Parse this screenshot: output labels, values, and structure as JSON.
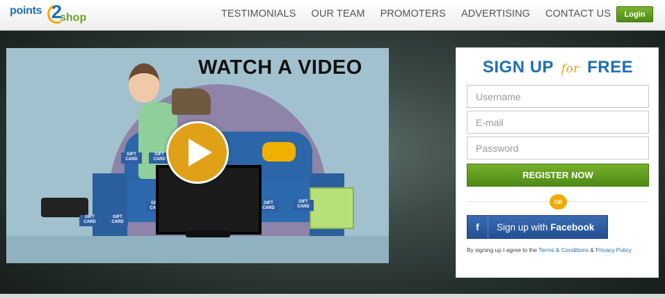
{
  "logo": {
    "part1": "points",
    "number": "2",
    "part2": "shop"
  },
  "nav": {
    "items": [
      "TESTIMONIALS",
      "OUR TEAM",
      "PROMOTERS",
      "ADVERTISING",
      "CONTACT US"
    ],
    "login_label": "Login"
  },
  "video": {
    "title": "WATCH A VIDEO",
    "gift_card_label": "GIFT CARD"
  },
  "signup": {
    "title_part1": "SIGN UP",
    "title_for": "for",
    "title_part2": "FREE",
    "username_placeholder": "Username",
    "email_placeholder": "E-mail",
    "password_placeholder": "Password",
    "register_label": "REGISTER NOW",
    "or_label": "OR",
    "facebook_prefix": "Sign up with",
    "facebook_brand": "Facebook",
    "facebook_icon_letter": "f",
    "terms_prefix": "By signing up I agree to the",
    "terms_link": "Terms & Conditions",
    "terms_amp": "&",
    "privacy_link": "Privacy Policy"
  },
  "colors": {
    "brand_blue": "#1d6fb3",
    "brand_green": "#6aa329",
    "accent_orange": "#e8a219",
    "facebook_blue": "#2d5ea6"
  }
}
